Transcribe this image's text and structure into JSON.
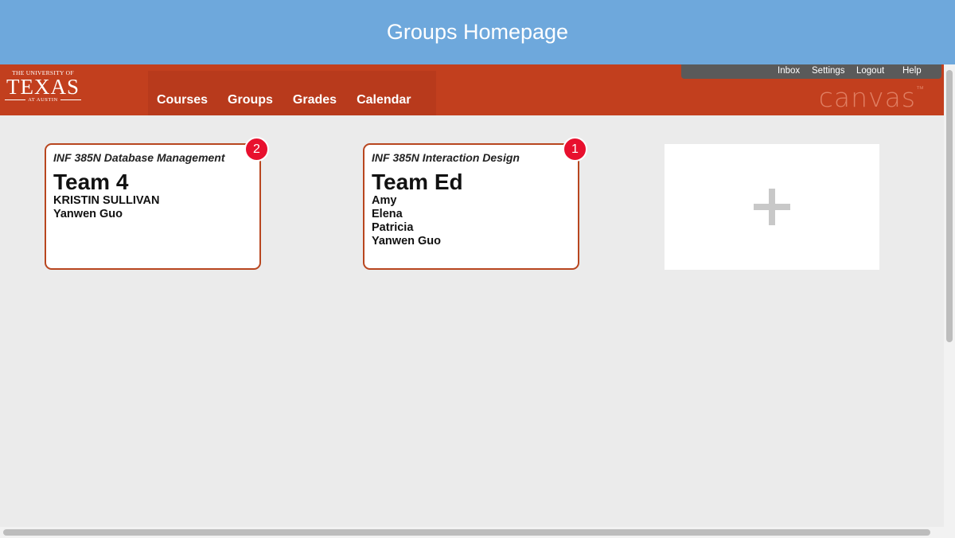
{
  "banner": {
    "title": "Groups Homepage"
  },
  "logo": {
    "line1": "THE UNIVERSITY OF",
    "line2": "TEXAS",
    "line3": "AT AUSTIN"
  },
  "nav": {
    "items": [
      "Courses",
      "Groups",
      "Grades",
      "Calendar"
    ]
  },
  "utility": {
    "items": [
      "Inbox",
      "Settings",
      "Logout",
      "Help"
    ]
  },
  "brand": {
    "name": "canvas",
    "tm": "™"
  },
  "groups": [
    {
      "course": "INF 385N Database Management",
      "team": "Team 4",
      "members": [
        "KRISTIN SULLIVAN",
        "Yanwen Guo"
      ],
      "badge": "2"
    },
    {
      "course": "INF 385N Interaction Design",
      "team": "Team Ed",
      "members": [
        "Amy",
        "Elena",
        "Patricia",
        "Yanwen Guo"
      ],
      "badge": "1"
    }
  ],
  "add_tile": {
    "icon": "plus-icon"
  },
  "colors": {
    "banner": "#6ea8dc",
    "nav_bar": "#c23f1e",
    "card_border": "#b8461f",
    "badge": "#e8102e",
    "page_bg": "#ebebeb"
  }
}
